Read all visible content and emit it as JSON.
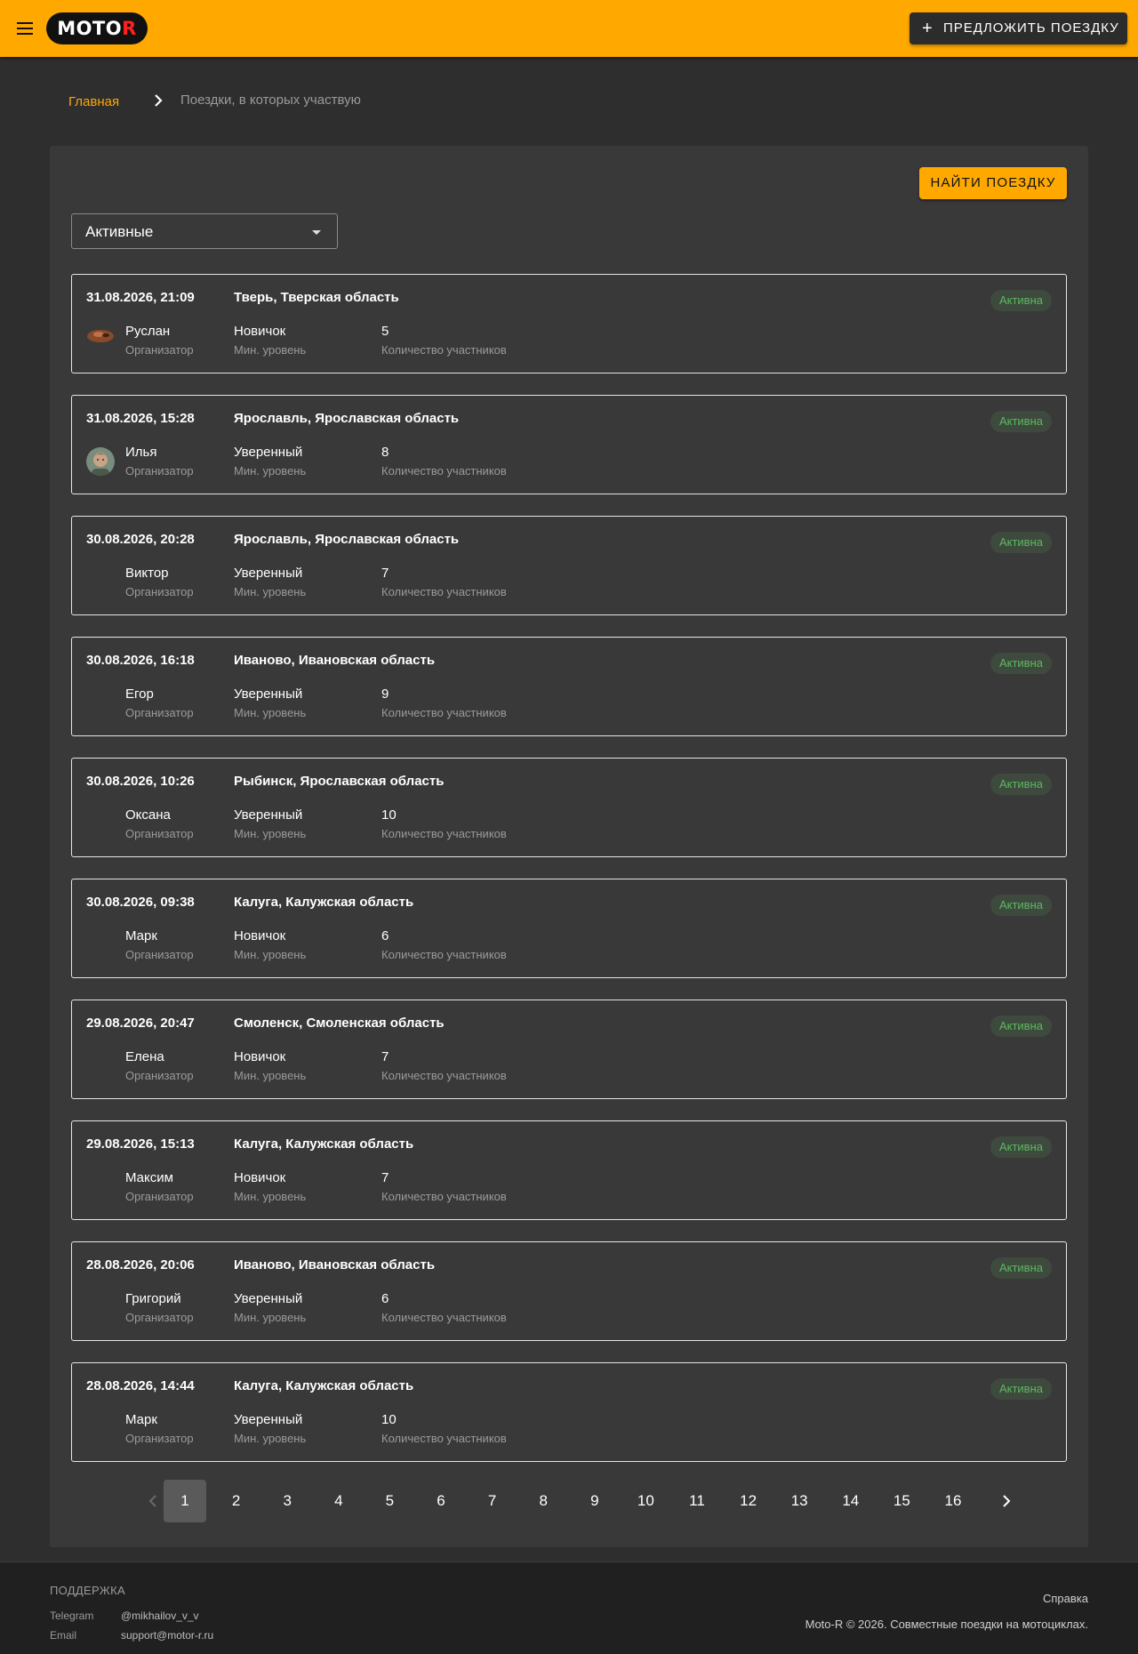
{
  "header": {
    "logo_prefix": "MOTO",
    "logo_accent": "R",
    "propose_label": "ПРЕДЛОЖИТЬ ПОЕЗДКУ",
    "colors": {
      "brand": "#ffa800",
      "logo_accent": "#ff1f1f"
    }
  },
  "breadcrumb": {
    "home": "Главная",
    "current": "Поездки, в которых участвую"
  },
  "toolbar": {
    "find_label": "НАЙТИ ПОЕЗДКУ",
    "filter_value": "Активные"
  },
  "captions": {
    "organizer": "Организатор",
    "min_level": "Мин. уровень",
    "participants": "Количество участников"
  },
  "trips": [
    {
      "date": "31.08.2026, 21:09",
      "place": "Тверь, Тверская область",
      "status": "Активна",
      "organizer": "Руслан",
      "level": "Новичок",
      "count": "5",
      "avatar": "photo"
    },
    {
      "date": "31.08.2026, 15:28",
      "place": "Ярославль, Ярославская область",
      "status": "Активна",
      "organizer": "Илья",
      "level": "Уверенный",
      "count": "8",
      "avatar": "photo"
    },
    {
      "date": "30.08.2026, 20:28",
      "place": "Ярославль, Ярославская область",
      "status": "Активна",
      "organizer": "Виктор",
      "level": "Уверенный",
      "count": "7",
      "avatar": "none"
    },
    {
      "date": "30.08.2026, 16:18",
      "place": "Иваново, Ивановская область",
      "status": "Активна",
      "organizer": "Егор",
      "level": "Уверенный",
      "count": "9",
      "avatar": "none"
    },
    {
      "date": "30.08.2026, 10:26",
      "place": "Рыбинск, Ярославская область",
      "status": "Активна",
      "organizer": "Оксана",
      "level": "Уверенный",
      "count": "10",
      "avatar": "none"
    },
    {
      "date": "30.08.2026, 09:38",
      "place": "Калуга, Калужская область",
      "status": "Активна",
      "organizer": "Марк",
      "level": "Новичок",
      "count": "6",
      "avatar": "none"
    },
    {
      "date": "29.08.2026, 20:47",
      "place": "Смоленск, Смоленская область",
      "status": "Активна",
      "organizer": "Елена",
      "level": "Новичок",
      "count": "7",
      "avatar": "none"
    },
    {
      "date": "29.08.2026, 15:13",
      "place": "Калуга, Калужская область",
      "status": "Активна",
      "organizer": "Максим",
      "level": "Новичок",
      "count": "7",
      "avatar": "none"
    },
    {
      "date": "28.08.2026, 20:06",
      "place": "Иваново, Ивановская область",
      "status": "Активна",
      "organizer": "Григорий",
      "level": "Уверенный",
      "count": "6",
      "avatar": "none"
    },
    {
      "date": "28.08.2026, 14:44",
      "place": "Калуга, Калужская область",
      "status": "Активна",
      "organizer": "Марк",
      "level": "Уверенный",
      "count": "10",
      "avatar": "none"
    }
  ],
  "pagination": {
    "pages": [
      "1",
      "2",
      "3",
      "4",
      "5",
      "6",
      "7",
      "8",
      "9",
      "10",
      "11",
      "12",
      "13",
      "14",
      "15",
      "16"
    ],
    "current": "1",
    "prev_icon": "chevron-left-icon",
    "next_icon": "chevron-right-icon"
  },
  "footer": {
    "support_title": "ПОДДЕРЖКА",
    "contacts": [
      {
        "label": "Telegram",
        "value": "@mikhailov_v_v"
      },
      {
        "label": "Email",
        "value": "support@motor-r.ru"
      }
    ],
    "help": "Справка",
    "copyright": "Moto-R © 2026. Совместные поездки на мотоциклах."
  }
}
